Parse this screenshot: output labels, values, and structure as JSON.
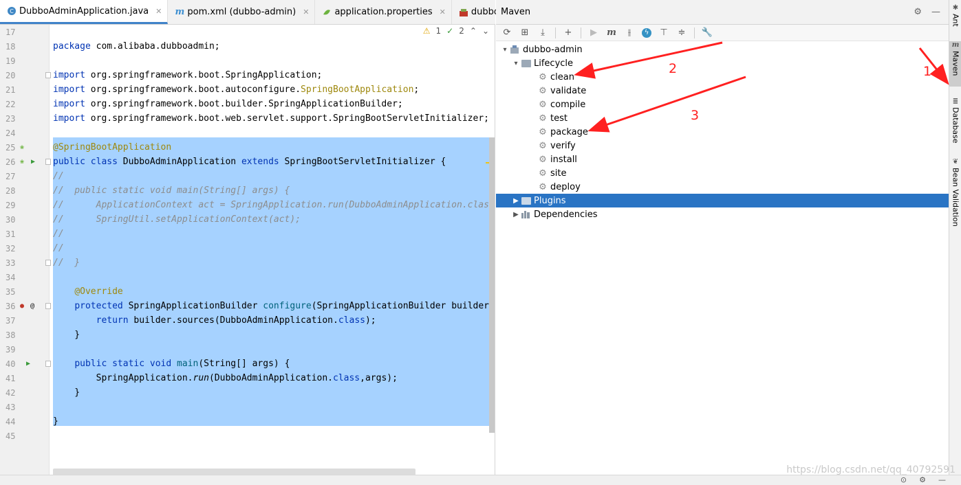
{
  "editor": {
    "tabs": [
      {
        "label": "DubboAdminApplication.java",
        "icon": "java-class-icon"
      },
      {
        "label": "pom.xml (dubbo-admin)",
        "icon": "maven-icon"
      },
      {
        "label": "application.properties",
        "icon": "properties-icon"
      },
      {
        "label": "dubbo-admi",
        "icon": "module-icon"
      }
    ],
    "inspections": {
      "warnings": "1",
      "checks": "2"
    },
    "lines": [
      {
        "n": "17"
      },
      {
        "n": "18",
        "parts": [
          [
            "kw",
            "package"
          ],
          [
            "",
            " com.alibaba.dubboadmin;"
          ]
        ]
      },
      {
        "n": "19"
      },
      {
        "n": "20",
        "parts": [
          [
            "kw",
            "import"
          ],
          [
            "",
            " org.springframework.boot.SpringApplication;"
          ]
        ]
      },
      {
        "n": "21",
        "parts": [
          [
            "kw",
            "import"
          ],
          [
            "",
            " org.springframework.boot.autoconfigure."
          ],
          [
            "an",
            "SpringBootApplication"
          ],
          [
            "",
            ";"
          ]
        ]
      },
      {
        "n": "22",
        "parts": [
          [
            "kw",
            "import"
          ],
          [
            "",
            " org.springframework.boot.builder.SpringApplicationBuilder;"
          ]
        ]
      },
      {
        "n": "23",
        "parts": [
          [
            "kw",
            "import"
          ],
          [
            "",
            " org.springframework.boot.web.servlet.support.SpringBootServletInitializer;"
          ]
        ]
      },
      {
        "n": "24"
      },
      {
        "n": "25",
        "parts": [
          [
            "an",
            "@SpringBootApplication"
          ]
        ]
      },
      {
        "n": "26",
        "parts": [
          [
            "kw",
            "public class"
          ],
          [
            "",
            " DubboAdminApplication "
          ],
          [
            "kw",
            "extends"
          ],
          [
            "",
            " SpringBootServletInitializer {"
          ]
        ]
      },
      {
        "n": "27",
        "parts": [
          [
            "cm",
            "//"
          ]
        ]
      },
      {
        "n": "28",
        "parts": [
          [
            "cm",
            "//  public static void main(String[] args) {"
          ]
        ]
      },
      {
        "n": "29",
        "parts": [
          [
            "cm",
            "//      ApplicationContext act = SpringApplication.run(DubboAdminApplication.class, args);"
          ]
        ]
      },
      {
        "n": "30",
        "parts": [
          [
            "cm",
            "//      SpringUtil.setApplicationContext(act);"
          ]
        ]
      },
      {
        "n": "31",
        "parts": [
          [
            "cm",
            "//"
          ]
        ]
      },
      {
        "n": "32",
        "parts": [
          [
            "cm",
            "//"
          ]
        ]
      },
      {
        "n": "33",
        "parts": [
          [
            "cm",
            "//  }"
          ]
        ]
      },
      {
        "n": "34"
      },
      {
        "n": "35",
        "parts": [
          [
            "",
            "    "
          ],
          [
            "an",
            "@Override"
          ]
        ]
      },
      {
        "n": "36",
        "parts": [
          [
            "",
            "    "
          ],
          [
            "kw",
            "protected"
          ],
          [
            "",
            " SpringApplicationBuilder "
          ],
          [
            "kw2",
            "configure"
          ],
          [
            "",
            "(SpringApplicationBuilder builder) {"
          ]
        ]
      },
      {
        "n": "37",
        "parts": [
          [
            "",
            "        "
          ],
          [
            "kw",
            "return"
          ],
          [
            "",
            " builder.sources(DubboAdminApplication."
          ],
          [
            "kw",
            "class"
          ],
          [
            "",
            ");"
          ]
        ]
      },
      {
        "n": "38",
        "parts": [
          [
            "",
            "    }"
          ]
        ]
      },
      {
        "n": "39"
      },
      {
        "n": "40",
        "parts": [
          [
            "",
            "    "
          ],
          [
            "kw",
            "public static void"
          ],
          [
            "",
            " "
          ],
          [
            "kw2",
            "main"
          ],
          [
            "",
            "(String[] args) {"
          ]
        ]
      },
      {
        "n": "41",
        "parts": [
          [
            "",
            "        SpringApplication."
          ],
          [
            "it",
            "run"
          ],
          [
            "",
            "(DubboAdminApplication."
          ],
          [
            "kw",
            "class"
          ],
          [
            "",
            ",args);"
          ]
        ]
      },
      {
        "n": "42",
        "parts": [
          [
            "",
            "    }"
          ]
        ]
      },
      {
        "n": "43"
      },
      {
        "n": "44",
        "parts": [
          [
            "",
            "}"
          ]
        ]
      },
      {
        "n": "45"
      }
    ]
  },
  "maven": {
    "title": "Maven",
    "project": "dubbo-admin",
    "lifecycle_label": "Lifecycle",
    "lifecycle": [
      "clean",
      "validate",
      "compile",
      "test",
      "package",
      "verify",
      "install",
      "site",
      "deploy"
    ],
    "plugins_label": "Plugins",
    "dependencies_label": "Dependencies"
  },
  "stripe": {
    "ant": "Ant",
    "maven": "Maven",
    "database": "Database",
    "bean_validation": "Bean Validation"
  },
  "annotations": {
    "n1": "1",
    "n2": "2",
    "n3": "3"
  },
  "watermark": "https://blog.csdn.net/qq_40792591",
  "colors": {
    "selection": "#a6d2ff",
    "tree_selected": "#2a74c4",
    "annotation": "#ff2020"
  }
}
